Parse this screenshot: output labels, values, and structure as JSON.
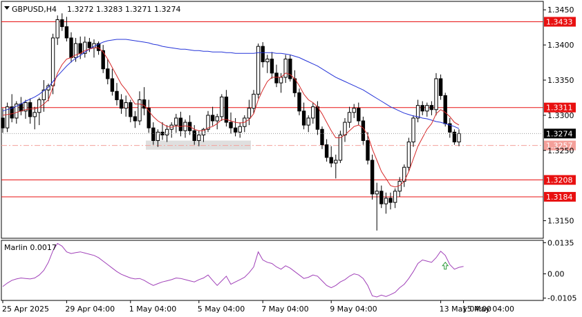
{
  "header": {
    "symbol": "GBPUSD,H4",
    "ohlc": "1.3272 1.3283 1.3271 1.3274"
  },
  "oscillator": {
    "label": "Marlin 0.0017",
    "ticks": [
      "0.0135",
      "0.00",
      "-0.0105"
    ]
  },
  "colors": {
    "background": "#ffffff",
    "frame": "#000000",
    "ma_fast": "#d62828",
    "ma_slow": "#2433d8",
    "level_line": "#e81010",
    "level_dash": "#f4a09a",
    "oscillator_line": "#a040b8",
    "signal_arrow": "#2e9a3a",
    "zone": "#d9d9d9"
  },
  "chart_data": [
    {
      "type": "candlestick",
      "symbol": "GBPUSD",
      "timeframe": "H4",
      "ylim": [
        1.3125,
        1.3462
      ],
      "yticks": [
        "1.3450",
        "1.3400",
        "1.3350",
        "1.3300",
        "1.3250",
        "1.3150"
      ],
      "x_labels": [
        "25 Apr 2025",
        "29 Apr 04:00",
        "1 May 04:00",
        "5 May 04:00",
        "7 May 04:00",
        "9 May 04:00",
        "13 May 04:00",
        "15 May 04:00"
      ],
      "current_price": "1.3274",
      "levels": [
        {
          "value": "1.3433",
          "style": "solid"
        },
        {
          "value": "1.3311",
          "style": "solid"
        },
        {
          "value": "1.3257",
          "style": "dashdot"
        },
        {
          "value": "1.3208",
          "style": "solid"
        },
        {
          "value": "1.3184",
          "style": "solid"
        }
      ],
      "zone": {
        "from": 1.3251,
        "to": 1.3264
      },
      "candles": [
        [
          1.3296,
          1.331,
          1.3275,
          1.3282
        ],
        [
          1.3282,
          1.3318,
          1.3276,
          1.3312
        ],
        [
          1.3312,
          1.333,
          1.329,
          1.3296
        ],
        [
          1.3296,
          1.332,
          1.3288,
          1.3316
        ],
        [
          1.3316,
          1.3326,
          1.33,
          1.3306
        ],
        [
          1.3306,
          1.3322,
          1.3295,
          1.3318
        ],
        [
          1.3318,
          1.3324,
          1.3288,
          1.3298
        ],
        [
          1.3298,
          1.3312,
          1.328,
          1.3304
        ],
        [
          1.3304,
          1.3325,
          1.3286,
          1.3322
        ],
        [
          1.3322,
          1.335,
          1.3305,
          1.3336
        ],
        [
          1.3336,
          1.3345,
          1.332,
          1.3342
        ],
        [
          1.3342,
          1.3416,
          1.333,
          1.341
        ],
        [
          1.341,
          1.3442,
          1.34,
          1.3436
        ],
        [
          1.3436,
          1.3445,
          1.342,
          1.3426
        ],
        [
          1.3426,
          1.344,
          1.3405,
          1.341
        ],
        [
          1.341,
          1.3418,
          1.3375,
          1.3382
        ],
        [
          1.3382,
          1.341,
          1.3376,
          1.3402
        ],
        [
          1.3402,
          1.3412,
          1.338,
          1.3388
        ],
        [
          1.3388,
          1.3412,
          1.3382,
          1.3404
        ],
        [
          1.3404,
          1.341,
          1.339,
          1.3396
        ],
        [
          1.3396,
          1.3408,
          1.3382,
          1.3402
        ],
        [
          1.3402,
          1.3405,
          1.3386,
          1.3392
        ],
        [
          1.3392,
          1.34,
          1.336,
          1.3366
        ],
        [
          1.3366,
          1.338,
          1.3344,
          1.3352
        ],
        [
          1.3352,
          1.3366,
          1.3328,
          1.3334
        ],
        [
          1.3334,
          1.3346,
          1.3314,
          1.3322
        ],
        [
          1.3322,
          1.333,
          1.3302,
          1.331
        ],
        [
          1.331,
          1.3328,
          1.3298,
          1.3318
        ],
        [
          1.3318,
          1.3322,
          1.329,
          1.3298
        ],
        [
          1.3298,
          1.3306,
          1.3282,
          1.3292
        ],
        [
          1.3292,
          1.3334,
          1.3286,
          1.3322
        ],
        [
          1.3322,
          1.334,
          1.33,
          1.331
        ],
        [
          1.331,
          1.3322,
          1.3275,
          1.3282
        ],
        [
          1.3282,
          1.329,
          1.3258,
          1.3264
        ],
        [
          1.3264,
          1.328,
          1.3255,
          1.3276
        ],
        [
          1.3276,
          1.329,
          1.3265,
          1.3272
        ],
        [
          1.3272,
          1.3286,
          1.3262,
          1.328
        ],
        [
          1.328,
          1.329,
          1.3268,
          1.3286
        ],
        [
          1.3286,
          1.3302,
          1.3275,
          1.3296
        ],
        [
          1.3296,
          1.3305,
          1.327,
          1.3278
        ],
        [
          1.3278,
          1.3294,
          1.3268,
          1.329
        ],
        [
          1.329,
          1.33,
          1.3272,
          1.3278
        ],
        [
          1.3278,
          1.3286,
          1.3258,
          1.3264
        ],
        [
          1.3264,
          1.3278,
          1.3256,
          1.3272
        ],
        [
          1.3272,
          1.3282,
          1.3262,
          1.328
        ],
        [
          1.328,
          1.3306,
          1.3276,
          1.33
        ],
        [
          1.33,
          1.3312,
          1.3285,
          1.3292
        ],
        [
          1.3292,
          1.3302,
          1.328,
          1.3298
        ],
        [
          1.3298,
          1.333,
          1.3292,
          1.3326
        ],
        [
          1.3326,
          1.3336,
          1.3284,
          1.329
        ],
        [
          1.329,
          1.3304,
          1.3274,
          1.3282
        ],
        [
          1.3282,
          1.3296,
          1.327,
          1.3276
        ],
        [
          1.3276,
          1.329,
          1.3268,
          1.3284
        ],
        [
          1.3284,
          1.33,
          1.3276,
          1.3296
        ],
        [
          1.3296,
          1.3322,
          1.3286,
          1.331
        ],
        [
          1.331,
          1.3336,
          1.3302,
          1.333
        ],
        [
          1.333,
          1.3402,
          1.3324,
          1.3398
        ],
        [
          1.3398,
          1.3404,
          1.3368,
          1.3376
        ],
        [
          1.3376,
          1.3386,
          1.336,
          1.338
        ],
        [
          1.338,
          1.339,
          1.3352,
          1.336
        ],
        [
          1.336,
          1.3372,
          1.334,
          1.3346
        ],
        [
          1.3346,
          1.336,
          1.3332,
          1.3354
        ],
        [
          1.3354,
          1.3386,
          1.3346,
          1.338
        ],
        [
          1.338,
          1.3386,
          1.3348,
          1.3352
        ],
        [
          1.3352,
          1.3364,
          1.3326,
          1.3332
        ],
        [
          1.3332,
          1.3338,
          1.33,
          1.3306
        ],
        [
          1.3306,
          1.3318,
          1.328,
          1.3286
        ],
        [
          1.3286,
          1.33,
          1.3276,
          1.3296
        ],
        [
          1.3296,
          1.3318,
          1.3288,
          1.3312
        ],
        [
          1.3312,
          1.332,
          1.3272,
          1.328
        ],
        [
          1.328,
          1.3284,
          1.3252,
          1.3258
        ],
        [
          1.3258,
          1.3266,
          1.3234,
          1.324
        ],
        [
          1.324,
          1.3256,
          1.3226,
          1.3232
        ],
        [
          1.3232,
          1.3244,
          1.321,
          1.3236
        ],
        [
          1.3236,
          1.3278,
          1.3232,
          1.3272
        ],
        [
          1.3272,
          1.3296,
          1.3262,
          1.329
        ],
        [
          1.329,
          1.3312,
          1.3282,
          1.3304
        ],
        [
          1.3304,
          1.3316,
          1.3296,
          1.331
        ],
        [
          1.331,
          1.3318,
          1.3286,
          1.3292
        ],
        [
          1.3292,
          1.3298,
          1.3258,
          1.3264
        ],
        [
          1.3264,
          1.3276,
          1.323,
          1.3236
        ],
        [
          1.3236,
          1.3244,
          1.318,
          1.3188
        ],
        [
          1.3188,
          1.3204,
          1.3136,
          1.3192
        ],
        [
          1.3192,
          1.32,
          1.3168,
          1.3174
        ],
        [
          1.3174,
          1.319,
          1.316,
          1.3182
        ],
        [
          1.3182,
          1.319,
          1.3166,
          1.3176
        ],
        [
          1.3176,
          1.3196,
          1.3168,
          1.3192
        ],
        [
          1.3192,
          1.3212,
          1.3184,
          1.3206
        ],
        [
          1.3206,
          1.323,
          1.3198,
          1.3226
        ],
        [
          1.3226,
          1.3268,
          1.322,
          1.3262
        ],
        [
          1.3262,
          1.33,
          1.3255,
          1.3296
        ],
        [
          1.3296,
          1.3322,
          1.329,
          1.3314
        ],
        [
          1.3314,
          1.332,
          1.33,
          1.3306
        ],
        [
          1.3306,
          1.3318,
          1.3298,
          1.3314
        ],
        [
          1.3314,
          1.332,
          1.33,
          1.3308
        ],
        [
          1.3308,
          1.336,
          1.33,
          1.3352
        ],
        [
          1.3352,
          1.3358,
          1.3322,
          1.3328
        ],
        [
          1.3328,
          1.3332,
          1.3284,
          1.3288
        ],
        [
          1.3288,
          1.3296,
          1.3268,
          1.3276
        ],
        [
          1.3276,
          1.328,
          1.3258,
          1.3262
        ],
        [
          1.3262,
          1.328,
          1.3256,
          1.3274
        ]
      ],
      "ma_fast": [
        1.33,
        1.3301,
        1.3302,
        1.3304,
        1.3306,
        1.3308,
        1.3309,
        1.3309,
        1.3311,
        1.3316,
        1.3322,
        1.334,
        1.336,
        1.3372,
        1.338,
        1.3382,
        1.3386,
        1.3388,
        1.3392,
        1.3394,
        1.3396,
        1.3396,
        1.339,
        1.338,
        1.3368,
        1.3356,
        1.3344,
        1.3336,
        1.3326,
        1.3316,
        1.3316,
        1.3314,
        1.3306,
        1.3298,
        1.3292,
        1.3288,
        1.3284,
        1.3283,
        1.3285,
        1.3284,
        1.3285,
        1.3284,
        1.328,
        1.3278,
        1.3278,
        1.3282,
        1.3284,
        1.3288,
        1.3294,
        1.3294,
        1.3292,
        1.329,
        1.3289,
        1.329,
        1.3294,
        1.3302,
        1.3322,
        1.3336,
        1.3348,
        1.3354,
        1.3354,
        1.3354,
        1.336,
        1.3358,
        1.3352,
        1.3342,
        1.333,
        1.3322,
        1.3318,
        1.3312,
        1.3302,
        1.329,
        1.3278,
        1.3268,
        1.3268,
        1.3272,
        1.3278,
        1.3284,
        1.3286,
        1.3282,
        1.3272,
        1.3252,
        1.3236,
        1.322,
        1.321,
        1.32,
        1.3198,
        1.32,
        1.3206,
        1.322,
        1.3238,
        1.3256,
        1.3268,
        1.328,
        1.3288,
        1.3302,
        1.3308,
        1.3304,
        1.3298,
        1.329,
        1.3286
      ],
      "ma_slow": [
        1.3306,
        1.3308,
        1.331,
        1.3313,
        1.3316,
        1.332,
        1.3323,
        1.3326,
        1.333,
        1.3335,
        1.334,
        1.3348,
        1.3356,
        1.3363,
        1.337,
        1.3376,
        1.3381,
        1.3385,
        1.339,
        1.3394,
        1.3398,
        1.3401,
        1.3404,
        1.3406,
        1.3407,
        1.3408,
        1.3408,
        1.3408,
        1.3407,
        1.3406,
        1.3405,
        1.3404,
        1.3403,
        1.3401,
        1.34,
        1.3398,
        1.3397,
        1.3396,
        1.3395,
        1.3394,
        1.3394,
        1.3393,
        1.3392,
        1.3392,
        1.3391,
        1.3391,
        1.339,
        1.339,
        1.339,
        1.3389,
        1.3389,
        1.3388,
        1.3388,
        1.3388,
        1.3388,
        1.3388,
        1.3389,
        1.3389,
        1.3389,
        1.3389,
        1.3388,
        1.3388,
        1.3387,
        1.3386,
        1.3384,
        1.3382,
        1.3379,
        1.3376,
        1.3373,
        1.337,
        1.3366,
        1.3362,
        1.3358,
        1.3354,
        1.3351,
        1.3348,
        1.3345,
        1.3342,
        1.3339,
        1.3336,
        1.3332,
        1.3328,
        1.3324,
        1.332,
        1.3316,
        1.3312,
        1.3309,
        1.3306,
        1.3303,
        1.3301,
        1.3299,
        1.3298,
        1.3296,
        1.3295,
        1.3293,
        1.3291,
        1.329,
        1.3288,
        1.3286,
        1.3284,
        1.3281
      ]
    },
    {
      "type": "line",
      "name": "Marlin",
      "ylim": [
        -0.0115,
        0.0145
      ],
      "signal_arrow_index": 97,
      "values": [
        -0.0055,
        -0.004,
        -0.0028,
        -0.0022,
        -0.0018,
        -0.002,
        -0.0022,
        -0.0018,
        -0.0005,
        0.0015,
        0.005,
        0.01,
        0.0132,
        0.012,
        0.0095,
        0.0088,
        0.0092,
        0.0095,
        0.009,
        0.0085,
        0.008,
        0.007,
        0.0055,
        0.004,
        0.0025,
        0.001,
        -0.0002,
        -0.001,
        -0.0018,
        -0.0022,
        -0.002,
        -0.0028,
        -0.004,
        -0.005,
        -0.0042,
        -0.0035,
        -0.003,
        -0.0025,
        -0.0018,
        -0.002,
        -0.0025,
        -0.003,
        -0.0035,
        -0.0025,
        -0.0018,
        -0.0005,
        -0.0028,
        -0.005,
        -0.003,
        -0.001,
        -0.0045,
        -0.0035,
        -0.0025,
        -0.0015,
        0.0005,
        0.003,
        0.0095,
        0.006,
        0.005,
        0.0045,
        0.003,
        0.002,
        0.0035,
        0.0025,
        0.001,
        -0.0005,
        -0.002,
        -0.0015,
        -0.0005,
        -0.001,
        -0.003,
        -0.005,
        -0.006,
        -0.005,
        -0.0035,
        -0.0025,
        -0.001,
        0.0,
        -0.0005,
        -0.002,
        -0.005,
        -0.0095,
        -0.01,
        -0.0092,
        -0.0098,
        -0.009,
        -0.008,
        -0.006,
        -0.0045,
        -0.002,
        0.001,
        0.0045,
        0.006,
        0.0055,
        0.005,
        0.007,
        0.0098,
        0.008,
        0.004,
        0.002,
        0.0028,
        0.0032
      ]
    }
  ]
}
